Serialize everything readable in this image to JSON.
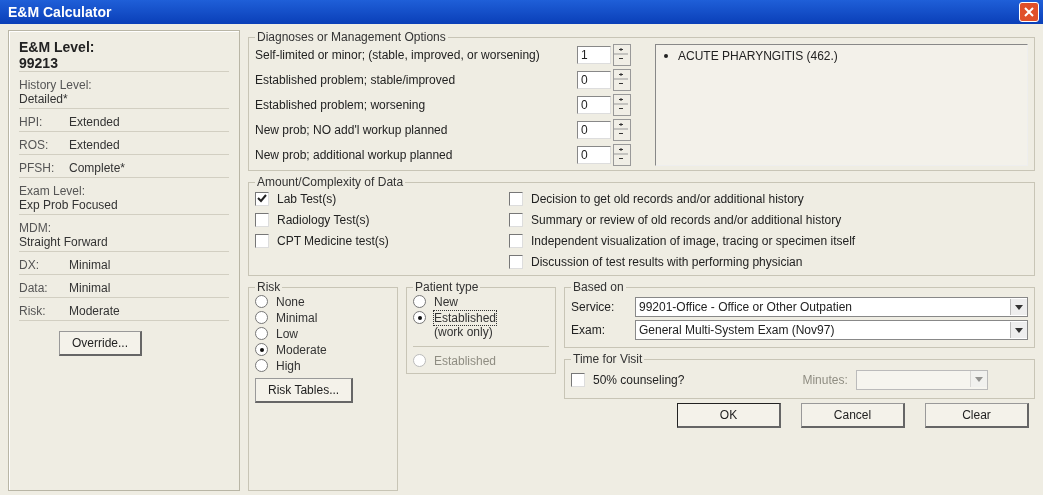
{
  "window": {
    "title": "E&M Calculator"
  },
  "summary": {
    "heading": "E&M Level:",
    "level": "99213",
    "fields": [
      {
        "kind": "stacked",
        "label": "History Level:",
        "value": "Detailed*"
      },
      {
        "kind": "inline",
        "label": "HPI:",
        "value": "Extended"
      },
      {
        "kind": "inline",
        "label": "ROS:",
        "value": "Extended"
      },
      {
        "kind": "inline",
        "label": "PFSH:",
        "value": "Complete*"
      },
      {
        "kind": "stacked",
        "label": "Exam Level:",
        "value": "Exp Prob Focused"
      },
      {
        "kind": "stacked",
        "label": "MDM:",
        "value": "Straight Forward"
      },
      {
        "kind": "inline",
        "label": "DX:",
        "value": "Minimal"
      },
      {
        "kind": "inline",
        "label": "Data:",
        "value": "Minimal"
      },
      {
        "kind": "inline",
        "label": "Risk:",
        "value": "Moderate"
      }
    ],
    "button": "Override..."
  },
  "diagnoses": {
    "title": "Diagnoses or Management Options",
    "rows": [
      {
        "label": "Self-limited or minor; (stable, improved, or worsening)",
        "value": "1"
      },
      {
        "label": "Established problem; stable/improved",
        "value": "0"
      },
      {
        "label": "Established problem; worsening",
        "value": "0"
      },
      {
        "label": "New prob; NO add'l workup planned",
        "value": "0"
      },
      {
        "label": "New prob; additional workup planned",
        "value": "0"
      }
    ],
    "list": [
      "ACUTE PHARYNGITIS (462.)"
    ]
  },
  "data": {
    "title": "Amount/Complexity of Data",
    "left": [
      {
        "label": "Lab Test(s)",
        "checked": true
      },
      {
        "label": "Radiology Test(s)",
        "checked": false
      },
      {
        "label": "CPT Medicine test(s)",
        "checked": false
      }
    ],
    "right": [
      {
        "label": "Decision to get old records and/or additional history",
        "checked": false
      },
      {
        "label": "Summary or review of old records and/or additional history",
        "checked": false
      },
      {
        "label": "Independent visualization of image, tracing or specimen itself",
        "checked": false
      },
      {
        "label": "Discussion of test results with performing physician",
        "checked": false
      }
    ]
  },
  "risk": {
    "title": "Risk",
    "options": [
      {
        "label": "None",
        "selected": false
      },
      {
        "label": "Minimal",
        "selected": false
      },
      {
        "label": "Low",
        "selected": false
      },
      {
        "label": "Moderate",
        "selected": true
      },
      {
        "label": "High",
        "selected": false
      }
    ],
    "button": "Risk Tables..."
  },
  "patient_type": {
    "title": "Patient type",
    "options": [
      {
        "label": "New",
        "selected": false,
        "disabled": false
      },
      {
        "label": "Established",
        "note": "(work only)",
        "selected": true,
        "disabled": false
      },
      {
        "label": "Established",
        "selected": false,
        "disabled": true
      }
    ]
  },
  "based_on": {
    "title": "Based on",
    "fields": [
      {
        "label": "Service:",
        "value": "99201-Office - Office or Other Outpatien"
      },
      {
        "label": "Exam:",
        "value": "General Multi-System Exam (Nov97)"
      }
    ]
  },
  "time_for_visit": {
    "title": "Time for Visit",
    "counseling": {
      "label": "50% counseling?",
      "checked": false
    },
    "minutes": {
      "label": "Minutes:",
      "disabled": true
    }
  },
  "buttons": [
    {
      "label": "OK",
      "default": true
    },
    {
      "label": "Cancel",
      "default": false
    },
    {
      "label": "Clear",
      "default": false
    }
  ]
}
